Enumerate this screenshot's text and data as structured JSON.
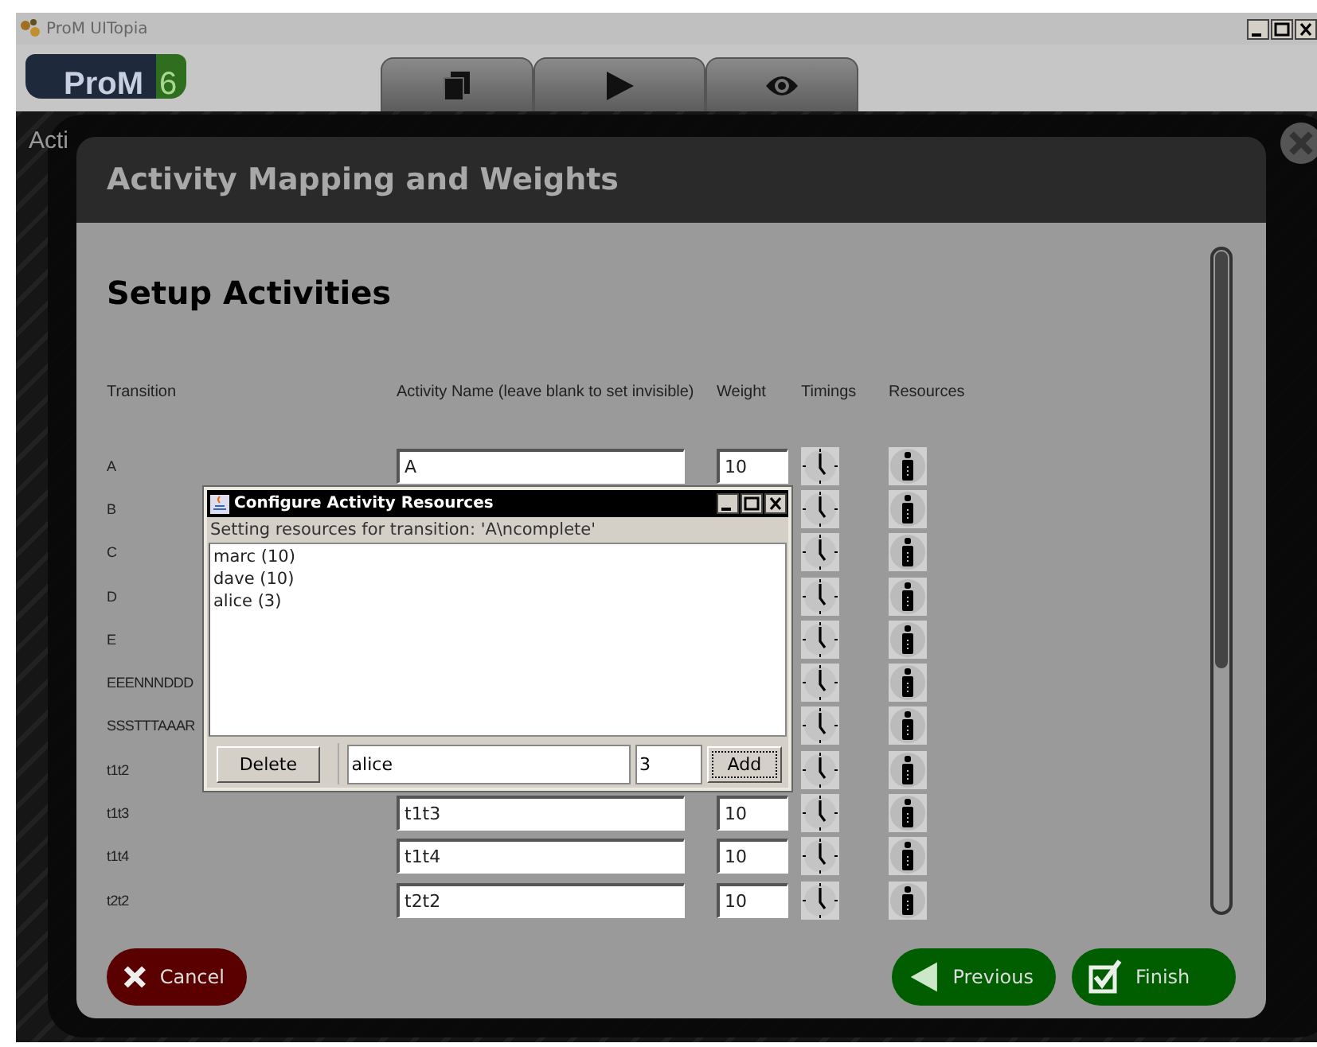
{
  "window": {
    "title": "ProM UITopia"
  },
  "header": {
    "logo": {
      "name": "ProM",
      "version": "6"
    },
    "tabs": [
      {
        "kind": "copy"
      },
      {
        "kind": "play"
      },
      {
        "kind": "view"
      }
    ]
  },
  "background_view": {
    "title": "Acti"
  },
  "wizard": {
    "title": "Activity Mapping and Weights",
    "heading": "Setup Activities",
    "columns": [
      "Transition",
      "Activity Name (leave blank to set invisible)",
      "Weight",
      "Timings",
      "Resources"
    ],
    "rows": [
      {
        "transition": "A",
        "activity_name": "A",
        "weight": "10"
      },
      {
        "transition": "B"
      },
      {
        "transition": "C"
      },
      {
        "transition": "D"
      },
      {
        "transition": "E"
      },
      {
        "transition": "EEENNNDDD"
      },
      {
        "transition": "SSSTTTAAAR"
      },
      {
        "transition": "t1t2"
      },
      {
        "transition": "t1t3",
        "activity_name": "t1t3",
        "weight": "10"
      },
      {
        "transition": "t1t4",
        "activity_name": "t1t4",
        "weight": "10"
      },
      {
        "transition": "t2t2",
        "activity_name": "t2t2",
        "weight": "10"
      }
    ],
    "buttons": [
      {
        "kind": "cancel",
        "label": "Cancel"
      },
      {
        "kind": "previous",
        "label": "Previous"
      },
      {
        "kind": "finish",
        "label": "Finish"
      }
    ]
  },
  "dialog": {
    "title": "Configure Activity Resources",
    "message": "Setting resources for transition: 'A\\ncomplete'",
    "resources": [
      "marc (10)",
      "dave (10)",
      "alice (3)"
    ],
    "delete_button": "Delete",
    "name_value": "alice",
    "amount_value": "3",
    "add_button": "Add"
  }
}
